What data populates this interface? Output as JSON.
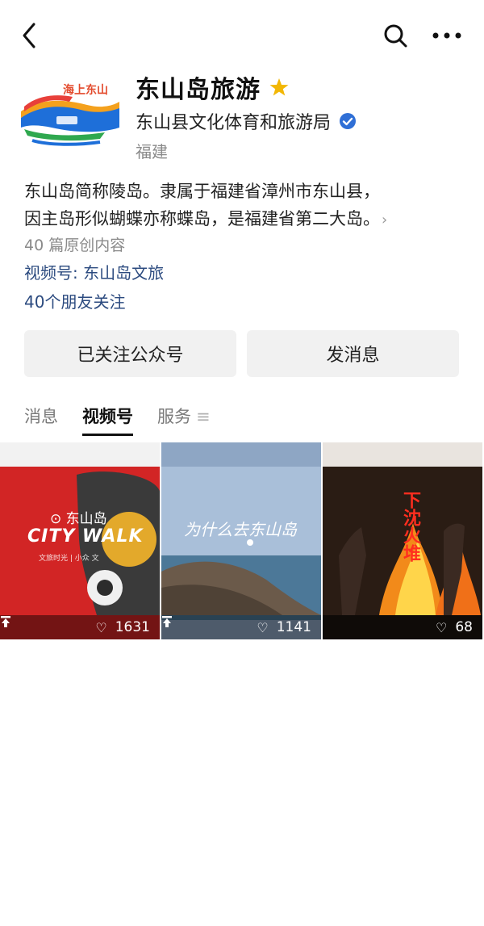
{
  "account": {
    "name": "东山岛旅游",
    "org": "东山县文化体育和旅游局",
    "region": "福建",
    "description_line1": "东山岛简称陵岛。隶属于福建省漳州市东山县，",
    "description_line2": "因主岛形似蝴蝶亦称蝶岛，是福建省第二大岛。",
    "original_count": "40 篇原创内容",
    "channel": "视频号: 东山岛文旅",
    "friends_following": "40个朋友关注",
    "avatar_logo_text": "海上东山"
  },
  "buttons": {
    "followed": "已关注公众号",
    "message": "发消息"
  },
  "tabs": [
    {
      "label": "消息",
      "active": false
    },
    {
      "label": "视频号",
      "active": true
    },
    {
      "label": "服务",
      "active": false
    }
  ],
  "videos": [
    {
      "likes": "1631",
      "pinned": true,
      "overlay_location": "东山岛",
      "overlay_title": "CITY WALK",
      "overlay_sub": "文旅时光 | 小众 文"
    },
    {
      "likes": "1141",
      "pinned": true,
      "overlay_title": "为什么去东山岛"
    },
    {
      "likes": "68",
      "pinned": false,
      "overlay_title": "下沈火堆"
    }
  ],
  "icons": {
    "back": "chevron-left-icon",
    "search": "search-icon",
    "more": "more-icon",
    "star": "star-icon",
    "verified": "verified-icon",
    "heart": "heart-icon",
    "pin": "pin-icon",
    "tab_menu": "menu-icon"
  },
  "colors": {
    "link": "#2b4a7f",
    "star": "#f2b705",
    "verified": "#2f6fd6",
    "button_bg": "#f1f1f1"
  }
}
